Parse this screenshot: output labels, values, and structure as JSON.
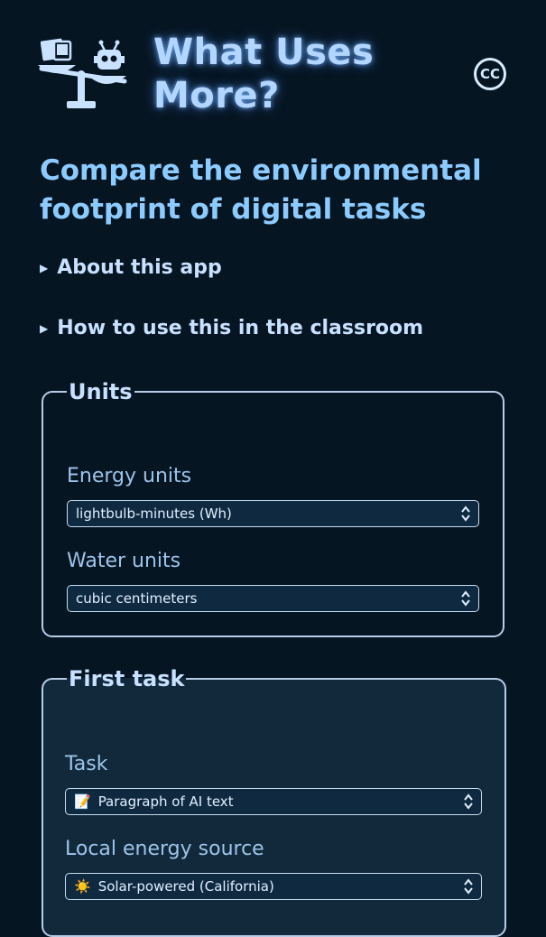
{
  "header": {
    "title_line1": "What Uses",
    "title_line2": "More?",
    "logo_icon": "scale-phone-robot-icon",
    "license_badge": "CC"
  },
  "subtitle": "Compare the environmental footprint of digital tasks",
  "disclosures": [
    {
      "label": "About this app"
    },
    {
      "label": "How to use this in the classroom"
    }
  ],
  "units_panel": {
    "legend": "Units",
    "energy_label": "Energy units",
    "energy_value": "lightbulb-minutes (Wh)",
    "water_label": "Water units",
    "water_value": "cubic centimeters"
  },
  "first_task_panel": {
    "legend": "First task",
    "task_label": "Task",
    "task_emoji": "📝",
    "task_value": "Paragraph of AI text",
    "energy_source_label": "Local energy source",
    "energy_source_emoji": "☀️",
    "energy_source_value": "Solar-powered (California)"
  },
  "colors": {
    "background": "#061522",
    "title": "#b2d6ff",
    "subtitle": "#8ccbff",
    "panel_border": "#b7cce6",
    "task_panel_bg": "#12293b"
  }
}
